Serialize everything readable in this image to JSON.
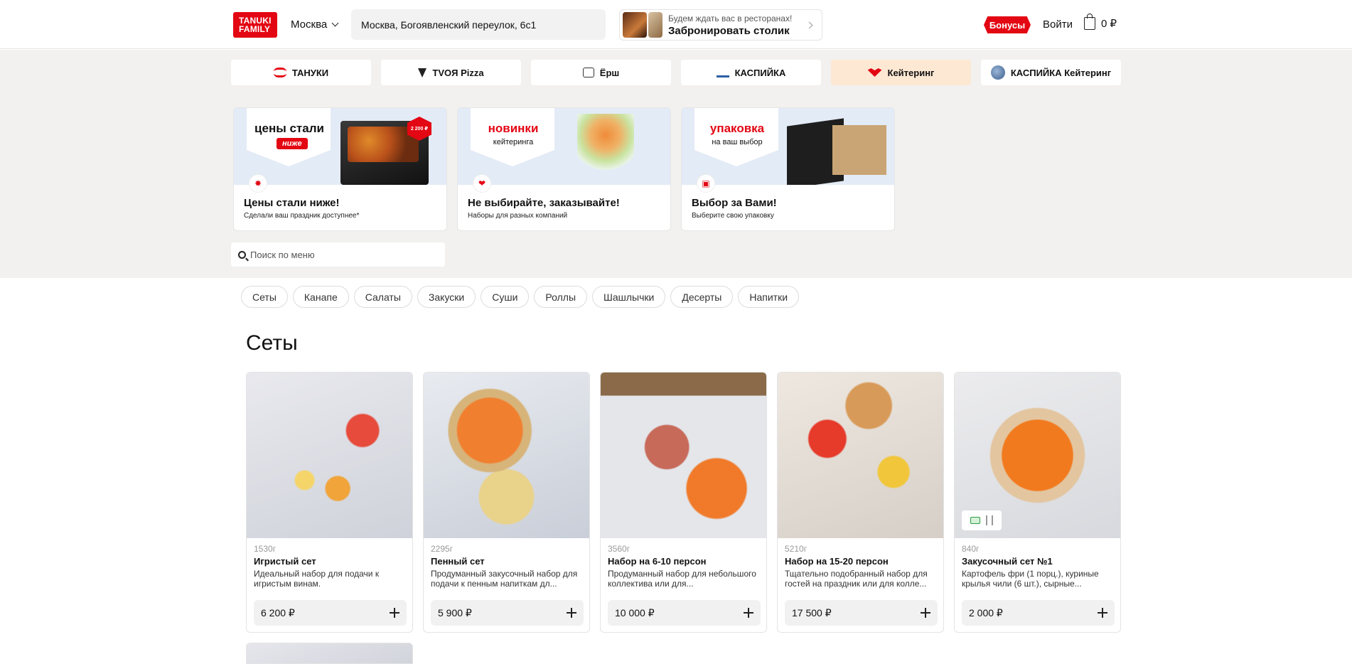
{
  "header": {
    "logo_line1": "TANUKI",
    "logo_line2": "FAMILY",
    "city": "Москва",
    "address": "Москва, Богоявленский переулок, 6с1",
    "booking_small": "Будем ждать вас в ресторанах!",
    "booking_big": "Забронировать столик",
    "bonus": "Бонусы",
    "login": "Войти",
    "cart_total": "0 ₽"
  },
  "brands": [
    {
      "label": "ТАНУКИ",
      "icon": "tanuki-icon"
    },
    {
      "label": "TVOЯ Pizza",
      "icon": "pizza-icon"
    },
    {
      "label": "Ёрш",
      "icon": "ersh-icon"
    },
    {
      "label": "КАСПИЙКА",
      "icon": "kaspiyka-icon"
    },
    {
      "label": "Кейтеринг",
      "icon": "heart-icon",
      "active": true
    },
    {
      "label": "КАСПИЙКА Кейтеринг",
      "icon": "globe-icon"
    }
  ],
  "promos": [
    {
      "banner_title": "цены стали",
      "banner_pill": "ниже",
      "badge": "2 200 ₽",
      "title": "Цены стали ниже!",
      "subtitle": "Сделали ваш праздник доступнее*"
    },
    {
      "banner_title": "новинки",
      "banner_sub": "кейтеринга",
      "title": "Не выбирайте, заказывайте!",
      "subtitle": "Наборы для разных компаний"
    },
    {
      "banner_title": "упаковка",
      "banner_sub": "на ваш выбор",
      "title": "Выбор за Вами!",
      "subtitle": "Выберите свою упаковку"
    }
  ],
  "search": {
    "placeholder": "Поиск по меню"
  },
  "categories": [
    "Сеты",
    "Канапе",
    "Салаты",
    "Закуски",
    "Суши",
    "Роллы",
    "Шашлычки",
    "Десерты",
    "Напитки"
  ],
  "section_title": "Сеты",
  "products": [
    {
      "weight": "1530г",
      "name": "Игристый сет",
      "desc": "Идеальный набор для подачи к игристым винам.",
      "price": "6 200 ₽"
    },
    {
      "weight": "2295г",
      "name": "Пенный сет",
      "desc": "Продуманный закусочный набор для подачи к пенным напиткам дл...",
      "price": "5 900 ₽"
    },
    {
      "weight": "3560г",
      "name": "Набор на 6-10 персон",
      "desc": "Продуманный набор для небольшого коллектива или для...",
      "price": "10 000 ₽"
    },
    {
      "weight": "5210г",
      "name": "Набор на 15-20 персон",
      "desc": "Тщательно подобранный набор для гостей на праздник или для колле...",
      "price": "17 500 ₽"
    },
    {
      "weight": "840г",
      "name": "Закусочный сет №1",
      "desc": "Картофель фри (1 порц.), куриные крылья чили (6 шт.), сырные...",
      "price": "2 000 ₽"
    }
  ],
  "colors": {
    "accent": "#e30613",
    "active_brand_bg": "#fde8d3",
    "page_grey": "#f2f1ef"
  }
}
